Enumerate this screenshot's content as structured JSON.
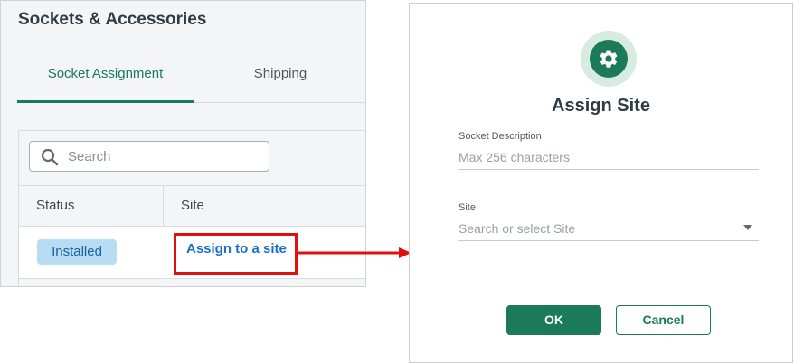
{
  "left_panel": {
    "title": "Sockets & Accessories",
    "tabs": [
      {
        "label": "Socket Assignment",
        "active": true
      },
      {
        "label": "Shipping",
        "active": false
      }
    ],
    "search": {
      "placeholder": "Search",
      "value": ""
    },
    "table": {
      "columns": [
        "Status",
        "Site"
      ],
      "rows": [
        {
          "status": "Installed",
          "site_action": "Assign to a site"
        }
      ]
    }
  },
  "modal": {
    "title": "Assign Site",
    "icon": "gear-icon",
    "fields": {
      "socket_description": {
        "label": "Socket Description",
        "placeholder": "Max 256 characters",
        "value": ""
      },
      "site": {
        "label": "Site:",
        "placeholder": "Search or select Site",
        "value": ""
      }
    },
    "buttons": {
      "ok": "OK",
      "cancel": "Cancel"
    }
  },
  "colors": {
    "accent_green": "#1b7a5a",
    "link_blue": "#1a6fc4",
    "status_badge_bg": "#b9dcf5",
    "highlight_red": "#e0100e"
  }
}
